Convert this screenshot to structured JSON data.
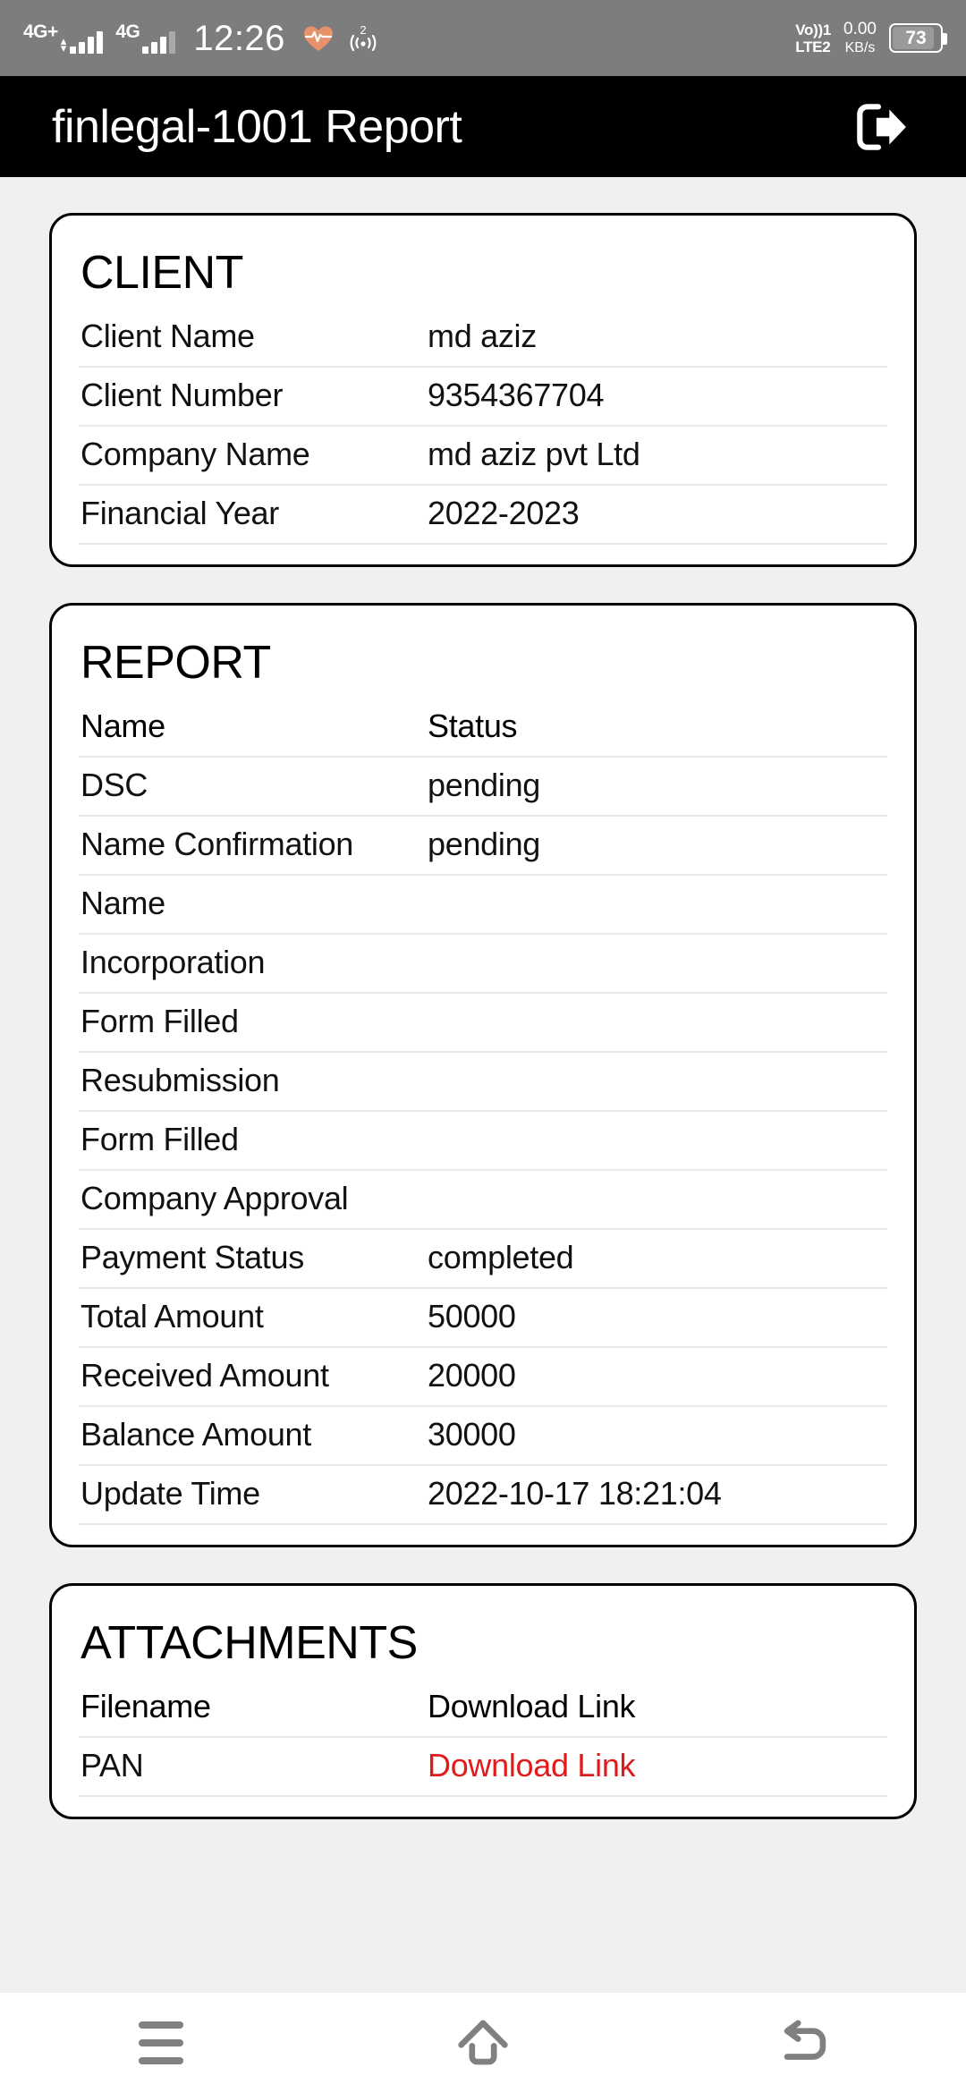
{
  "statusbar": {
    "sim1_label": "4G+",
    "sim2_label": "4G",
    "time": "12:26",
    "heart_icon": "heartbeat-icon",
    "hotspot_icon": "wireless-2-icon",
    "volte_line1": "Vo))1",
    "volte_line2": "LTE2",
    "netspeed_value": "0.00",
    "netspeed_unit": "KB/s",
    "battery_percent": "73"
  },
  "appbar": {
    "title": "finlegal-1001 Report",
    "logout_icon": "logout-icon"
  },
  "cards": [
    {
      "name": "client-card",
      "title": "CLIENT",
      "rows": [
        {
          "label": "Client Name",
          "value": "md aziz"
        },
        {
          "label": "Client Number",
          "value": "9354367704"
        },
        {
          "label": "Company Name",
          "value": "md aziz pvt Ltd"
        },
        {
          "label": "Financial Year",
          "value": "2022-2023"
        }
      ]
    },
    {
      "name": "report-card",
      "title": "REPORT",
      "header": {
        "label": "Name",
        "value": "Status"
      },
      "rows": [
        {
          "label": "DSC",
          "value": "pending"
        },
        {
          "label": "Name Confirmation",
          "value": "pending"
        },
        {
          "label": "Name",
          "value": ""
        },
        {
          "label": "Incorporation",
          "value": ""
        },
        {
          "label": "Form Filled",
          "value": ""
        },
        {
          "label": "Resubmission",
          "value": ""
        },
        {
          "label": "Form Filled",
          "value": ""
        },
        {
          "label": "Company Approval",
          "value": ""
        },
        {
          "label": "Payment Status",
          "value": "completed"
        },
        {
          "label": "Total Amount",
          "value": "50000"
        },
        {
          "label": "Received Amount",
          "value": "20000"
        },
        {
          "label": "Balance Amount",
          "value": "30000"
        },
        {
          "label": "Update Time",
          "value": "2022-10-17 18:21:04"
        }
      ]
    },
    {
      "name": "attachments-card",
      "title": "ATTACHMENTS",
      "header": {
        "label": "Filename",
        "value": "Download Link"
      },
      "rows": [
        {
          "label": "PAN",
          "value": "Download Link",
          "link": true
        }
      ]
    }
  ],
  "navbar": {
    "recents_icon": "hamburger-menu-icon",
    "home_icon": "home-icon",
    "back_icon": "back-arrow-icon"
  },
  "colors": {
    "statusbar_bg": "#7d7d7d",
    "appbar_bg": "#000000",
    "page_bg": "#f0f0f0",
    "card_bg": "#ffffff",
    "link_red": "#e01b1b",
    "heart_orange": "#e8926b",
    "nav_icon_gray": "#808080"
  }
}
